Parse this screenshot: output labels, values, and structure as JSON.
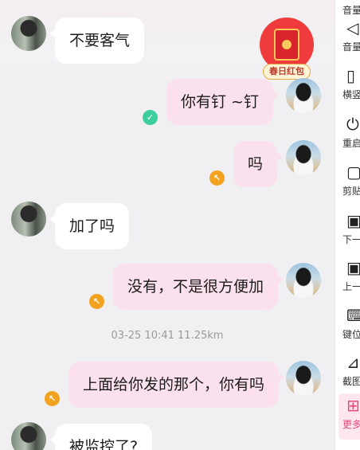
{
  "messages": [
    {
      "side": "in",
      "text": "不要客气"
    },
    {
      "side": "out",
      "text": "你有钉  ~钉",
      "status": "read"
    },
    {
      "side": "out",
      "text": "吗",
      "status": "unread"
    },
    {
      "side": "in",
      "text": "加了吗"
    },
    {
      "side": "out",
      "text": "没有，不是很方便加",
      "status": "unread"
    },
    {
      "side": "out",
      "text": "上面给你发的那个，你有吗",
      "status": "unread"
    },
    {
      "side": "in",
      "text": "被监控了?"
    }
  ],
  "timestamp": "03-25 10:41  11.25km",
  "red_packet": {
    "label": "春日红包",
    "icon": "red-envelope-icon"
  },
  "sidebar": {
    "items": [
      {
        "label": "音量",
        "icon": "volume-icon"
      },
      {
        "label": "音量",
        "icon": "volume-down-icon"
      },
      {
        "label": "横竖",
        "icon": "rotate-icon"
      },
      {
        "label": "重启",
        "icon": "power-icon"
      },
      {
        "label": "剪贴",
        "icon": "clipboard-icon"
      },
      {
        "label": "下一",
        "icon": "next-icon"
      },
      {
        "label": "上一",
        "icon": "previous-icon"
      },
      {
        "label": "键位",
        "icon": "keyboard-icon"
      },
      {
        "label": "截图",
        "icon": "crop-icon"
      },
      {
        "label": "更多",
        "icon": "grid-icon"
      }
    ],
    "active_color": "#e8457a"
  },
  "colors": {
    "out_bubble": "#fbe1ed",
    "in_bubble": "#ffffff",
    "read": "#3ecf9f",
    "unread": "#f2a21e"
  }
}
